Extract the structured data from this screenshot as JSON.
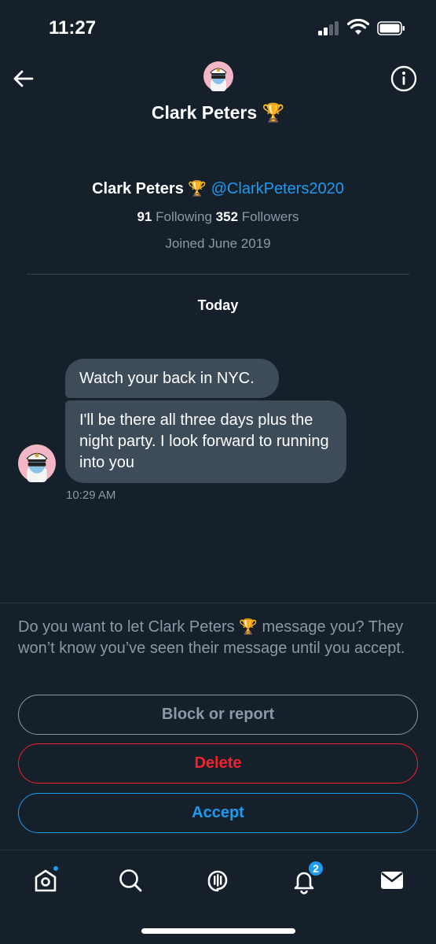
{
  "status_bar": {
    "time": "11:27"
  },
  "header": {
    "title": "Clark Peters 🏆",
    "back_icon": "arrow-left-icon",
    "info_icon": "info-circle-icon"
  },
  "profile": {
    "name": "Clark Peters",
    "trophy": "🏆",
    "handle": "@ClarkPeters2020",
    "following_count": "91",
    "following_label": "Following",
    "followers_count": "352",
    "followers_label": "Followers",
    "joined": "Joined June 2019"
  },
  "conversation": {
    "day_label": "Today",
    "messages": [
      {
        "text": "Watch your back in NYC."
      },
      {
        "text": "I'll be there all three days plus the night party. I look forward to running into you"
      }
    ],
    "time": "10:29 AM"
  },
  "request": {
    "prompt_before": "Do you want to let Clark Peters",
    "prompt_trophy": "🏆",
    "prompt_after": "message you? They won’t know you’ve seen their message until you accept.",
    "block_label": "Block or report",
    "delete_label": "Delete",
    "accept_label": "Accept"
  },
  "tabbar": {
    "notifications_badge": "2",
    "items": [
      "home-icon",
      "search-icon",
      "spaces-icon",
      "notifications-icon",
      "messages-icon"
    ]
  },
  "colors": {
    "background": "#15202b",
    "bubble": "#3e4c5a",
    "accent": "#1d9bf0",
    "danger": "#f4212e",
    "muted": "#8b98a5"
  }
}
